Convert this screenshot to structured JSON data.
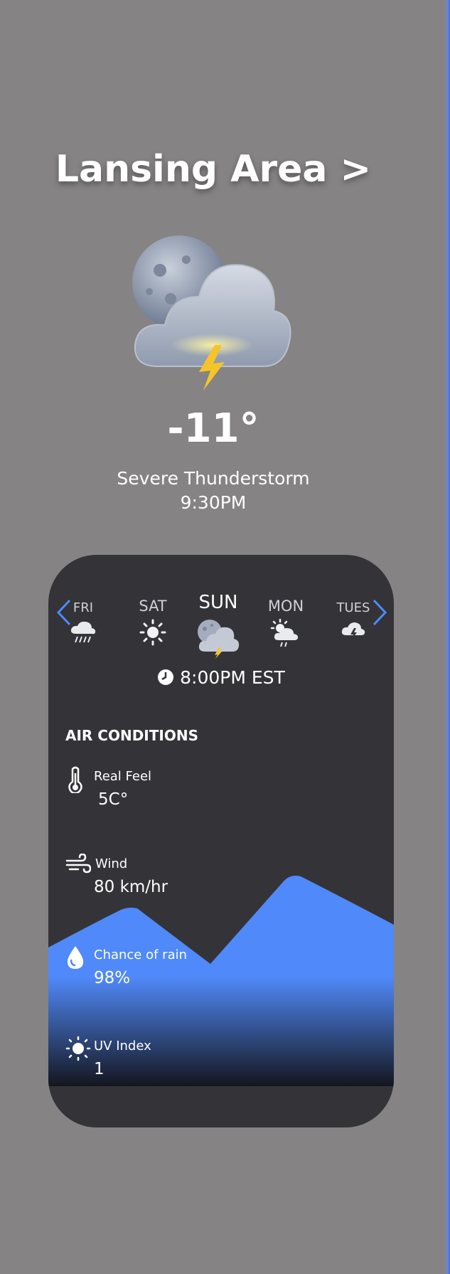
{
  "header": {
    "location": "Lansing Area >"
  },
  "current": {
    "temperature": "-11°",
    "condition": "Severe Thunderstorm",
    "time": "9:30PM",
    "icon": "moon-cloud-lightning-icon"
  },
  "forecast": {
    "days": [
      {
        "label": "FRI",
        "icon": "cloud-rain-icon"
      },
      {
        "label": "SAT",
        "icon": "sun-icon"
      },
      {
        "label": "SUN",
        "icon": "moon-cloud-lightning-icon",
        "selected": true
      },
      {
        "label": "MON",
        "icon": "sun-cloud-rain-icon"
      },
      {
        "label": "TUES",
        "icon": "cloud-lightning-icon"
      }
    ],
    "time": "8:00PM EST",
    "time_icon": "clock-icon",
    "nav_prev": "chevron-left-icon",
    "nav_next": "chevron-right-icon"
  },
  "air_conditions": {
    "title": "AIR CONDITIONS",
    "metrics": [
      {
        "name": "Real Feel",
        "value": "5C°",
        "icon": "thermometer-icon"
      },
      {
        "name": "Wind",
        "value": "80 km/hr",
        "icon": "wind-icon"
      },
      {
        "name": "Chance of rain",
        "value": "98%",
        "icon": "raindrop-icon"
      },
      {
        "name": "UV Index",
        "value": "1",
        "icon": "sun-icon"
      }
    ]
  },
  "colors": {
    "background": "#858384",
    "card": "#343338",
    "accent": "#5089f9",
    "text": "#ffffff"
  }
}
